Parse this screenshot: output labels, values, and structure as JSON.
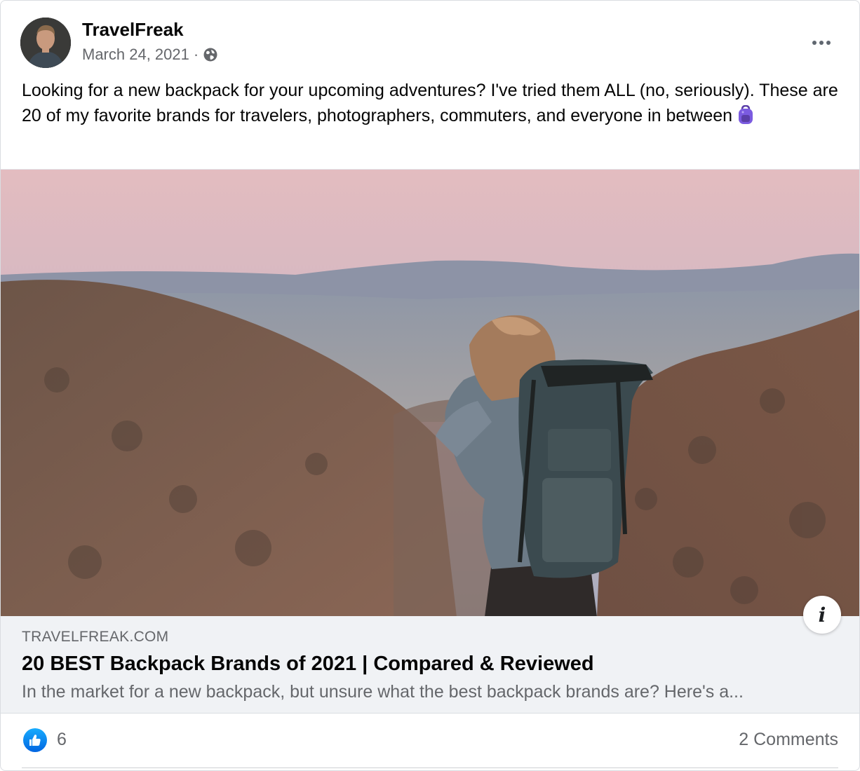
{
  "post": {
    "author": "TravelFreak",
    "date": "March 24, 2021",
    "separator": "·",
    "privacy_icon": "globe-icon",
    "menu_icon": "more-horizontal-icon",
    "message": "Looking for a new backpack for your upcoming adventures? I've tried them ALL (no, seriously). These are 20 of my favorite brands for travelers, photographers, commuters, and everyone in between",
    "message_emoji": "backpack-emoji"
  },
  "link_preview": {
    "domain": "TRAVELFREAK.COM",
    "title": "20 BEST Backpack Brands of 2021 | Compared & Reviewed",
    "description": "In the market for a new backpack, but unsure what the best backpack brands are? Here's a...",
    "info_icon": "info-icon"
  },
  "engagement": {
    "reaction_icon": "like-icon",
    "like_count": "6",
    "comments": "2 Comments"
  },
  "colors": {
    "like_blue": "#1877f2",
    "secondary_text": "#65676b",
    "preview_bg": "#f0f2f5"
  }
}
